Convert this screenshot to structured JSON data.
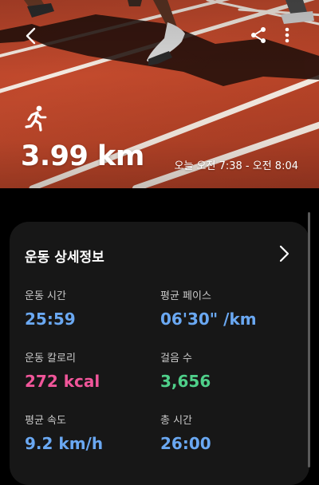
{
  "hero": {
    "distance": "3.99 km",
    "time_range": "오늘 오전 7:38 - 오전 8:04",
    "activity_icon": "running-person-icon"
  },
  "toolbar": {
    "back_icon": "back-arrow-icon",
    "share_icon": "share-icon",
    "more_icon": "more-vertical-icon"
  },
  "details": {
    "title": "운동 상세정보",
    "chevron_icon": "chevron-right-icon",
    "metrics": [
      {
        "label": "운동 시간",
        "value": "25:59",
        "color": "#6aa8f2"
      },
      {
        "label": "평균 페이스",
        "value": "06'30\" /km",
        "color": "#6aa8f2"
      },
      {
        "label": "운동 칼로리",
        "value": "272 kcal",
        "color": "#f0569a"
      },
      {
        "label": "걸음 수",
        "value": "3,656",
        "color": "#4fd08a"
      },
      {
        "label": "평균 속도",
        "value": "9.2 km/h",
        "color": "#6aa8f2"
      },
      {
        "label": "총 시간",
        "value": "26:00",
        "color": "#6aa8f2"
      }
    ]
  }
}
